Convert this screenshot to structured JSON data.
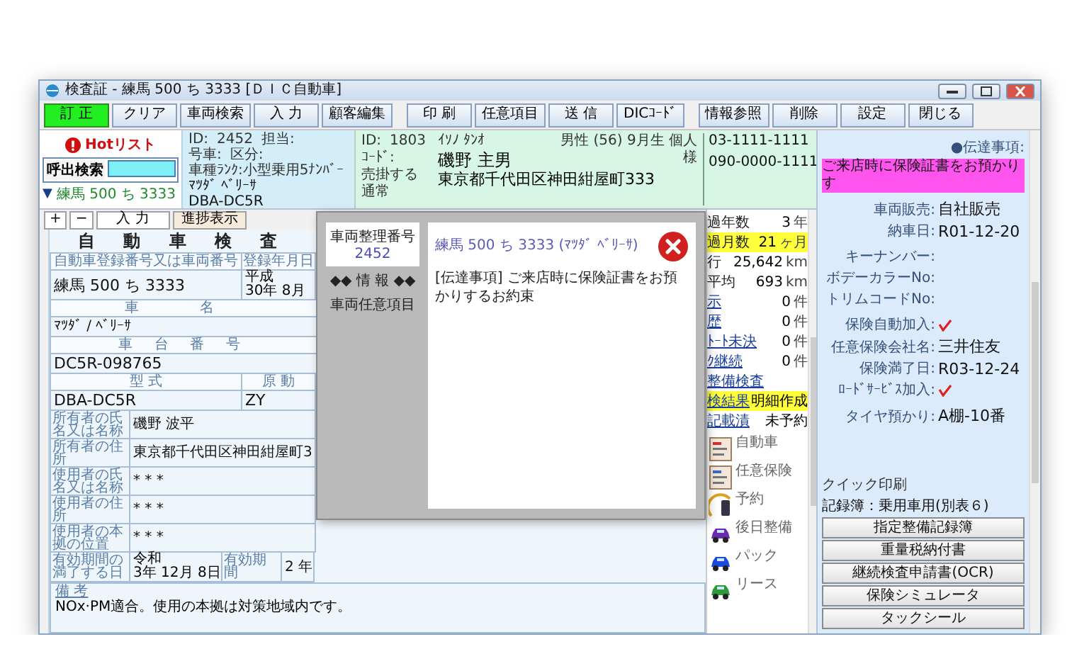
{
  "window": {
    "title": "検査証 - 練馬 500 ち 3333 [ＤＩＣ自動車]"
  },
  "toolbar": {
    "groups": [
      [
        {
          "label": "訂 正",
          "active": true
        },
        {
          "label": "クリア",
          "active": false
        },
        {
          "label": "車両検索",
          "active": false
        },
        {
          "label": "入 力",
          "active": false
        },
        {
          "label": "顧客編集",
          "active": false
        }
      ],
      [
        {
          "label": "印 刷",
          "active": false
        },
        {
          "label": "任意項目",
          "active": false
        },
        {
          "label": "送 信",
          "active": false
        },
        {
          "label": "DICｺｰﾄﾞ",
          "active": false
        }
      ],
      [
        {
          "label": "情報参照",
          "active": false
        },
        {
          "label": "削除",
          "active": false
        },
        {
          "label": "設定",
          "active": false
        },
        {
          "label": "閉じる",
          "active": false
        }
      ]
    ]
  },
  "search_panel": {
    "hot_list": "Hotリスト",
    "search_label": "呼出検索",
    "toggle": "▼",
    "plate": "練馬 500 ち 3333"
  },
  "vehicle_panel": {
    "id_label": "ID:",
    "id": "2452",
    "staff_label": "担当:",
    "car_no_label": "号車:",
    "class_label": "区分:",
    "rank": "車種ﾗﾝｸ:小型乗用5ﾅﾝﾊﾞｰ",
    "model": "ﾏﾂﾀﾞ ﾍﾞﾘｰｻ",
    "type": "DBA-DC5R"
  },
  "customer_panel": {
    "id_label": "ID:",
    "id": "1803",
    "code_label": "ｺｰﾄﾞ:",
    "billing": "売掛する",
    "billing_type": "通常",
    "kana": "ｲｿﾉ ﾀﾝｵ",
    "profile": "男性 (56) 9月生 個人",
    "name": "磯野 主男",
    "honorific": "様",
    "address": "東京都千代田区神田紺屋町333",
    "phones": [
      "03-1111-1111",
      "090-0000-1111"
    ]
  },
  "form_buttons": [
    "+",
    "−",
    "入 力",
    "進捗表示"
  ],
  "certificate": {
    "title": "自 動 車 検 査",
    "reg_no_label": "自動車登録番号又は車両番号",
    "reg_date_label": "登録年月日",
    "reg_no": "練馬 500 ち 3333",
    "reg_era": "平成",
    "reg_date": "30年 8月",
    "name_label": "車 名",
    "name": "ﾏﾂﾀﾞ / ﾍﾞﾘｰｻ",
    "chassis_label": "車 台 番 号",
    "chassis": "DC5R-098765",
    "type_label": "型 式",
    "engine_label": "原 動",
    "type": "DBA-DC5R",
    "engine": "ZY",
    "parties": [
      {
        "label": "所有者の氏名又は名称",
        "value": "磯野 波平"
      },
      {
        "label": "所有者の住所",
        "value": "東京都千代田区神田紺屋町3"
      },
      {
        "label": "使用者の氏名又は名称",
        "value": "* * *"
      },
      {
        "label": "使用者の住所",
        "value": "* * *"
      },
      {
        "label": "使用者の本拠の位置",
        "value": "* * *"
      }
    ],
    "expiry_label": "有効期間の満了する日",
    "expiry_era": "令和",
    "expiry": "3年 12月 8日",
    "term_label": "有効期間",
    "term": "2 年",
    "remarks_label": "備 考",
    "remarks": "NOx·PM適合。使用の本拠は対策地域内です。"
  },
  "stats": [
    {
      "label": "過年数",
      "value": "3",
      "unit": "年",
      "kind": "plain",
      "highlighted": false
    },
    {
      "label": "過月数",
      "value": "21",
      "unit": "ヶ月",
      "kind": "plain",
      "highlighted": true
    },
    {
      "label": "行",
      "value": "25,642",
      "unit": "km",
      "kind": "plain",
      "highlighted": false
    },
    {
      "label": "平均",
      "value": "693",
      "unit": "km",
      "kind": "plain",
      "highlighted": false
    },
    {
      "label": "示",
      "value": "0",
      "unit": "件",
      "kind": "link",
      "highlighted": false
    },
    {
      "label": "歴",
      "value": "0",
      "unit": "件",
      "kind": "link",
      "highlighted": false
    },
    {
      "label": "ﾄｰﾄ未決",
      "value": "0",
      "unit": "件",
      "kind": "link",
      "highlighted": false
    },
    {
      "label": "ｸ継続",
      "value": "0",
      "unit": "件",
      "kind": "link",
      "highlighted": false
    },
    {
      "label": "整備検査",
      "kind": "link",
      "highlighted": false
    },
    {
      "label": "検結果",
      "value": "明細作成",
      "kind": "link",
      "highlighted": true
    },
    {
      "label": "記載漬",
      "value": "未予約",
      "kind": "link",
      "highlighted": false
    }
  ],
  "shortcuts": [
    {
      "label": "自動車"
    },
    {
      "label": "任意保険"
    },
    {
      "label": "予約"
    },
    {
      "label": "後日整備"
    },
    {
      "label": "パック"
    },
    {
      "label": "リース"
    }
  ],
  "details": {
    "notice_label": "●伝達事項:",
    "notice": "ご来店時に保険証書をお預かりす",
    "sections": [
      [
        {
          "label": "車両販売:",
          "kind": "text",
          "value": "自社販売"
        },
        {
          "label": "納車日:",
          "kind": "text",
          "value": "R01-12-20"
        }
      ],
      [
        {
          "label": "キーナンバー:",
          "kind": "text"
        },
        {
          "label": "ボデーカラーNo:",
          "kind": "text"
        },
        {
          "label": "トリムコードNo:",
          "kind": "text"
        }
      ],
      [
        {
          "label": "保険自動加入:",
          "kind": "check",
          "checked": true
        },
        {
          "label": "任意保険会社名:",
          "kind": "text",
          "value": "三井住友"
        },
        {
          "label": "保険満了日:",
          "kind": "text",
          "value": "R03-12-24"
        },
        {
          "label": "ﾛｰﾄﾞｻｰﾋﾞｽ加入:",
          "kind": "check",
          "checked": true
        }
      ],
      [
        {
          "label": "タイヤ預かり:",
          "kind": "text",
          "value": "A棚-10番"
        }
      ]
    ]
  },
  "quick_print": {
    "label": "クイック印刷",
    "record": "記録簿：乗用車用(別表６)",
    "buttons": [
      "指定整備記録簿",
      "重量税納付書",
      "継続検査申請書(OCR)",
      "保険シミュレータ",
      "タックシール"
    ]
  },
  "dialog": {
    "number_label": "車両整理番号",
    "number": "2452",
    "info_heading": "◆◆ 情 報 ◆◆",
    "info_item": "車両任意項目",
    "title": "練馬 500 ち 3333 (ﾏﾂﾀﾞ ﾍﾞﾘｰｻ)",
    "message": "[伝達事項] ご来店時に保険証書をお預かりするお約束"
  }
}
